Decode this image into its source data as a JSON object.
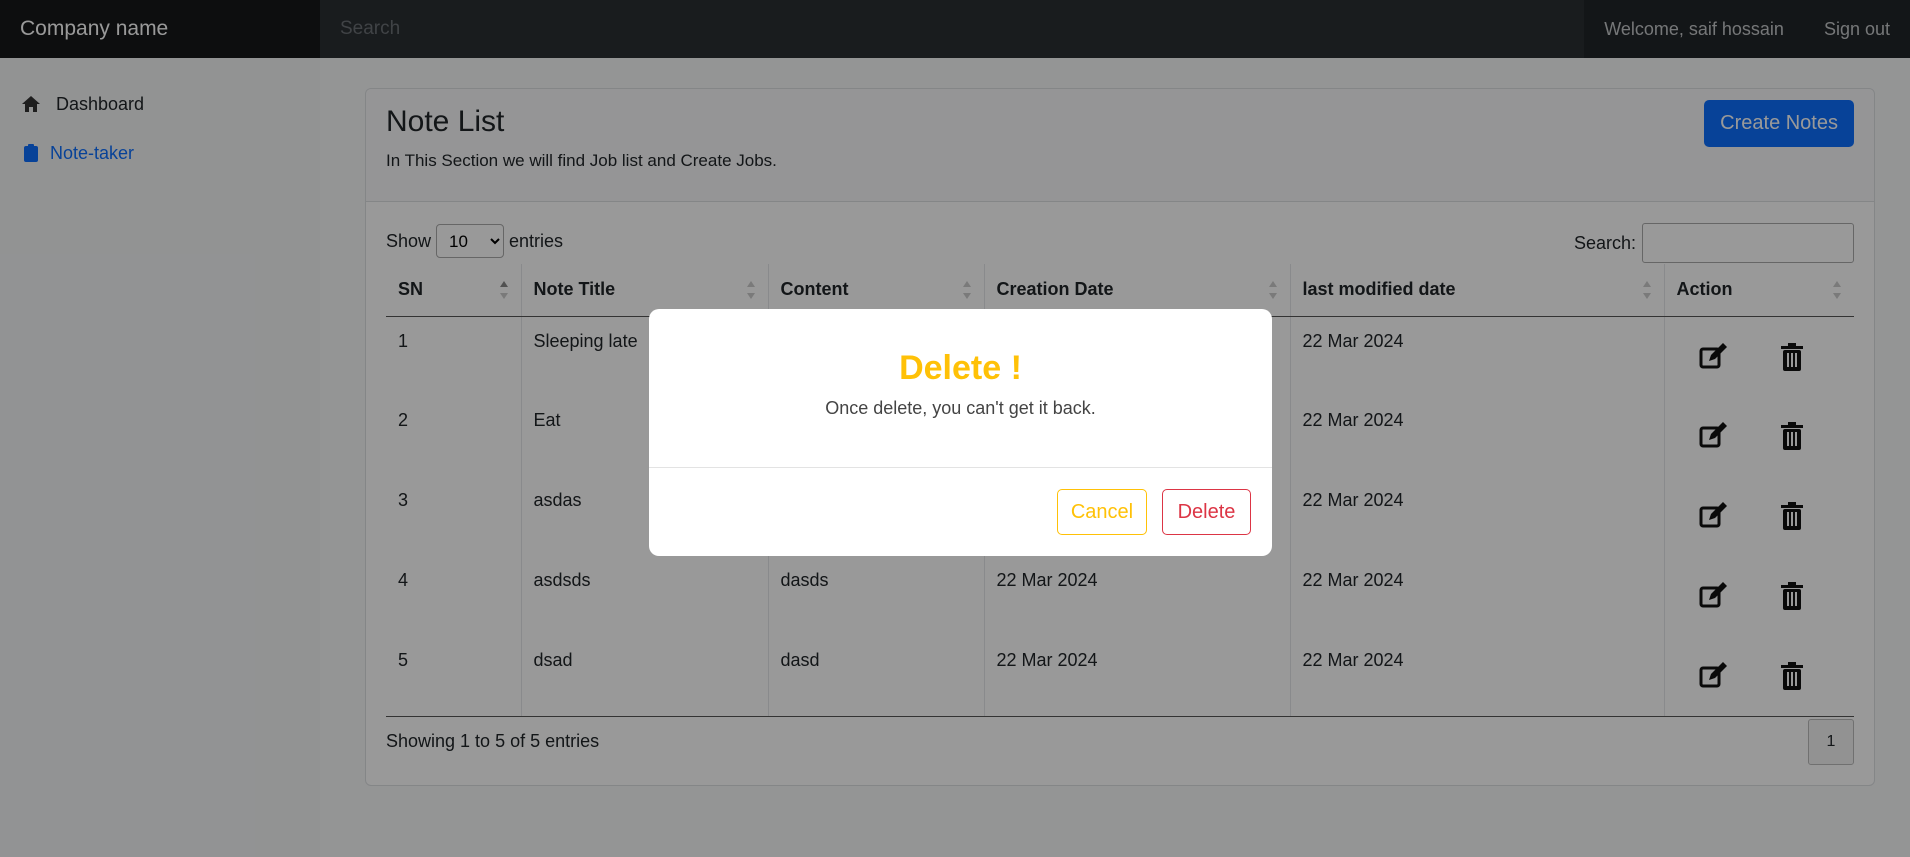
{
  "navbar": {
    "brand": "Company name",
    "search_placeholder": "Search",
    "welcome": "Welcome, saif hossain",
    "signout": "Sign out"
  },
  "sidebar": {
    "items": [
      {
        "label": "Dashboard",
        "icon": "home-icon",
        "active": false
      },
      {
        "label": "Note-taker",
        "icon": "clipboard-icon",
        "active": true
      }
    ]
  },
  "page": {
    "title": "Note List",
    "subtitle": "In This Section we will find Job list and Create Jobs.",
    "create_button": "Create Notes",
    "show_label": "Show",
    "entries_value": "10",
    "entries_label": "entries",
    "search_label": "Search:",
    "footer_info": "Showing 1 to 5 of 5 entries",
    "page_number": "1"
  },
  "table": {
    "columns": [
      "SN",
      "Note Title",
      "Content",
      "Creation Date",
      "last modified date",
      "Action"
    ],
    "rows": [
      {
        "sn": "1",
        "title": "Sleeping late",
        "content": "",
        "created": "",
        "modified": "22 Mar 2024"
      },
      {
        "sn": "2",
        "title": "Eat",
        "content": "",
        "created": "",
        "modified": "22 Mar 2024"
      },
      {
        "sn": "3",
        "title": "asdas",
        "content": "",
        "created": "",
        "modified": "22 Mar 2024"
      },
      {
        "sn": "4",
        "title": "asdsds",
        "content": "dasds",
        "created": "22 Mar 2024",
        "modified": "22 Mar 2024"
      },
      {
        "sn": "5",
        "title": "dsad",
        "content": "dasd",
        "created": "22 Mar 2024",
        "modified": "22 Mar 2024"
      }
    ]
  },
  "modal": {
    "title": "Delete !",
    "message": "Once delete, you can't get it back.",
    "cancel": "Cancel",
    "delete": "Delete"
  },
  "colors": {
    "primary": "#0d6efd",
    "warning": "#ffc107",
    "danger": "#dc3545",
    "navbar": "#212529"
  }
}
